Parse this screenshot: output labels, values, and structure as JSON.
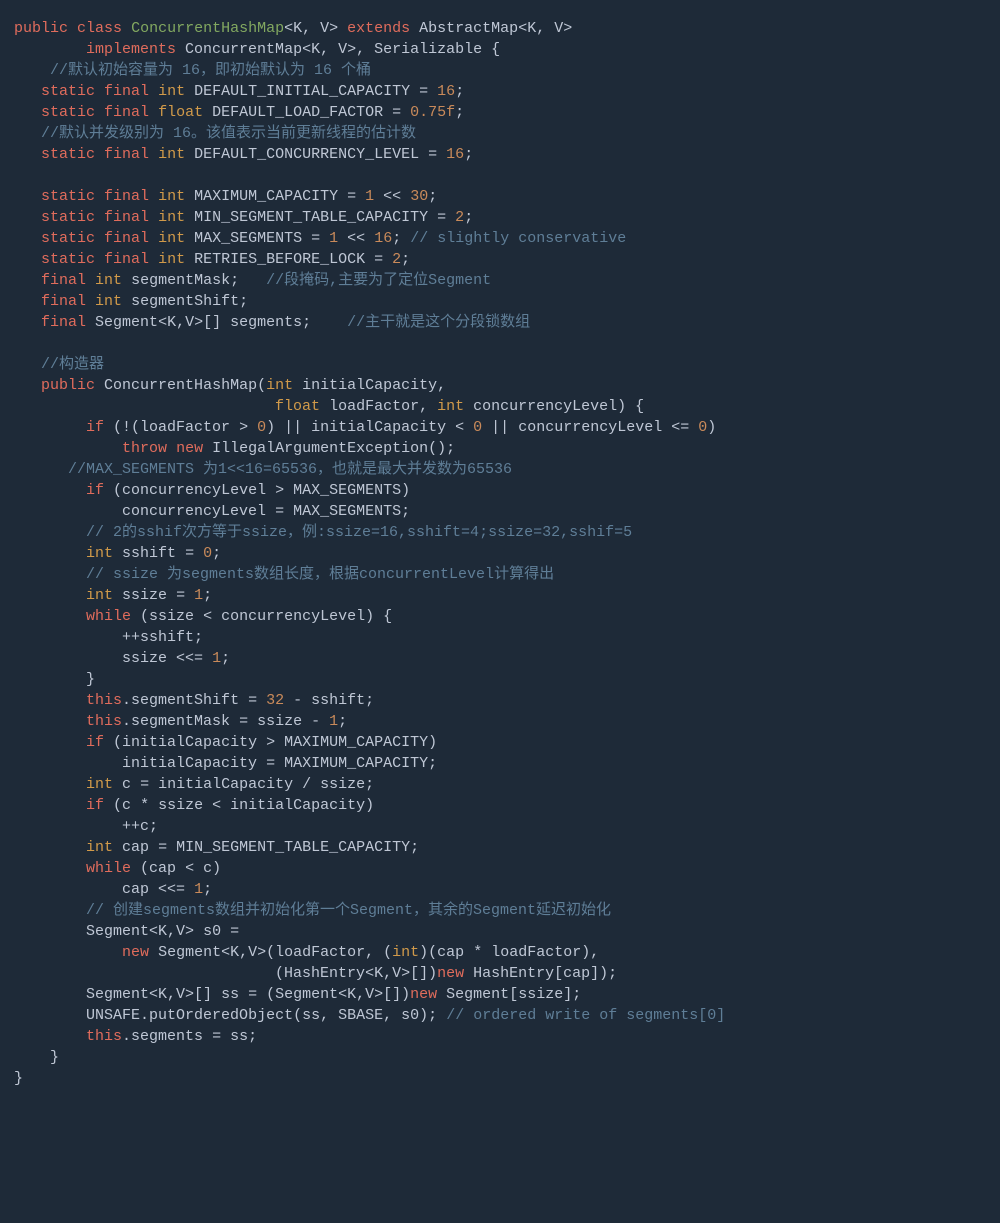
{
  "tokens": {
    "kw_public": "public",
    "kw_class": "class",
    "kw_extends": "extends",
    "kw_implements": "implements",
    "kw_static": "static",
    "kw_final": "final",
    "kw_int": "int",
    "kw_float": "float",
    "kw_if": "if",
    "kw_while": "while",
    "kw_throw": "throw",
    "kw_new": "new",
    "kw_this": "this",
    "cls_ConcurrentHashMap": "ConcurrentHashMap",
    "cls_AbstractMap": "AbstractMap",
    "cls_ConcurrentMap": "ConcurrentMap",
    "cls_Serializable": "Serializable",
    "cls_IllegalArgumentException": "IllegalArgumentException",
    "cls_Segment": "Segment",
    "cls_HashEntry": "HashEntry",
    "cls_UNSAFE": "UNSAFE",
    "gen_KV": "<K, V>",
    "gen_KV_tight": "<K,V>",
    "id_DEFAULT_INITIAL_CAPACITY": "DEFAULT_INITIAL_CAPACITY",
    "id_DEFAULT_LOAD_FACTOR": "DEFAULT_LOAD_FACTOR",
    "id_DEFAULT_CONCURRENCY_LEVEL": "DEFAULT_CONCURRENCY_LEVEL",
    "id_MAXIMUM_CAPACITY": "MAXIMUM_CAPACITY",
    "id_MIN_SEGMENT_TABLE_CAPACITY": "MIN_SEGMENT_TABLE_CAPACITY",
    "id_MAX_SEGMENTS": "MAX_SEGMENTS",
    "id_RETRIES_BEFORE_LOCK": "RETRIES_BEFORE_LOCK",
    "id_segmentMask": "segmentMask",
    "id_segmentShift": "segmentShift",
    "id_segments": "segments",
    "id_initialCapacity": "initialCapacity",
    "id_loadFactor": "loadFactor",
    "id_concurrencyLevel": "concurrencyLevel",
    "id_sshift": "sshift",
    "id_ssize": "ssize",
    "id_c": "c",
    "id_cap": "cap",
    "id_s0": "s0",
    "id_ss": "ss",
    "id_SBASE": "SBASE",
    "id_putOrderedObject": "putOrderedObject",
    "n_16": "16",
    "n_0_75f": "0.75f",
    "n_1": "1",
    "n_30": "30",
    "n_2": "2",
    "n_0": "0",
    "n_32": "32",
    "cm_header": "//默认初始容量为 16，即初始默认为 16 个桶",
    "cm_concurrency": "//默认并发级别为 16。该值表示当前更新线程的估计数",
    "cm_slightly": "// slightly conservative",
    "cm_mask": "//段掩码,主要为了定位Segment",
    "cm_main": "//主干就是这个分段锁数组",
    "cm_ctor": "//构造器",
    "cm_max_segments": "//MAX_SEGMENTS 为1<<16=65536，也就是最大并发数为65536",
    "cm_sshift": "// 2的sshif次方等于ssize，例:ssize=16,sshift=4;ssize=32,sshif=5",
    "cm_ssize": "// ssize 为segments数组长度，根据concurrentLevel计算得出",
    "cm_create_seg": "// 创建segments数组并初始化第一个Segment，其余的Segment延迟初始化",
    "cm_ordered": "// ordered write of segments[0]"
  }
}
